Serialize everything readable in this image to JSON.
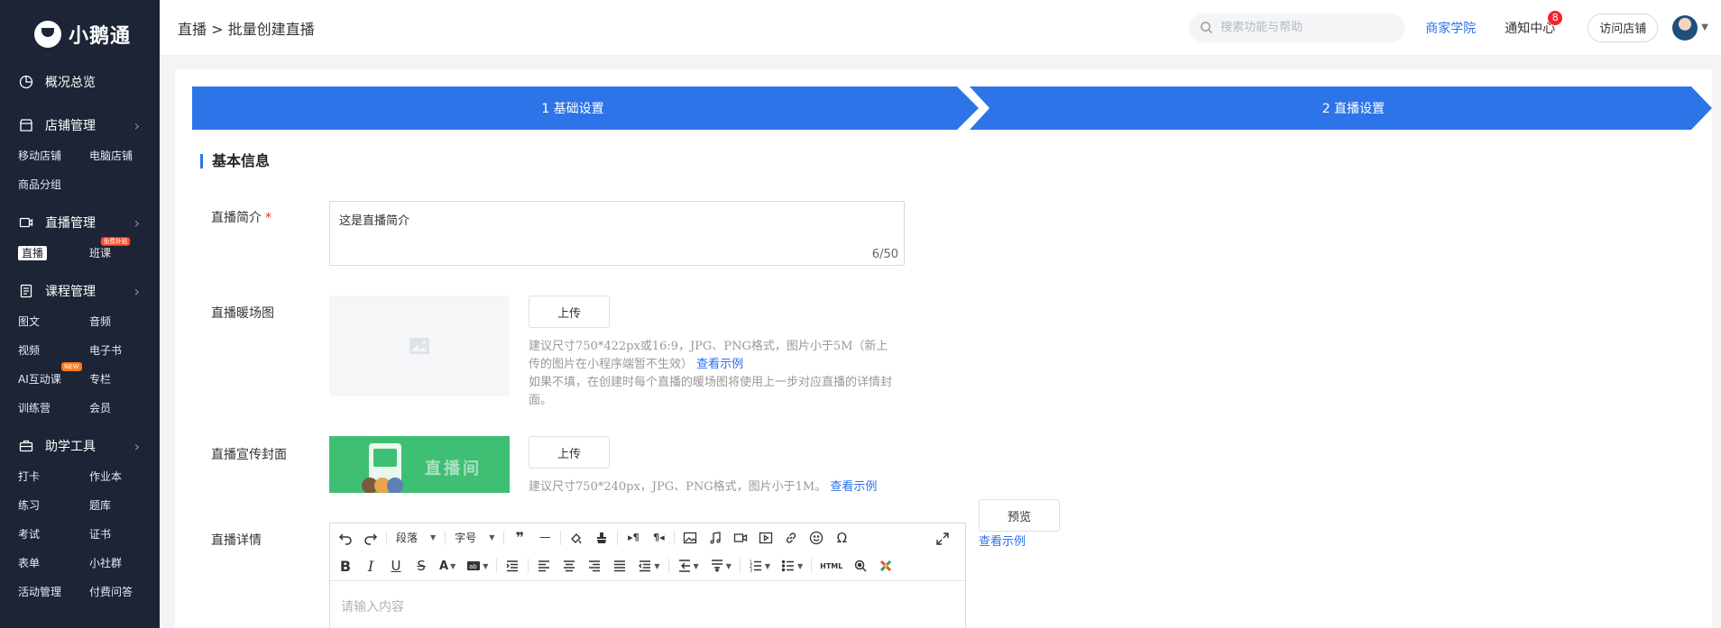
{
  "sidebar": {
    "logo_text": "小鹅通",
    "overview": "概况总览",
    "groups": [
      {
        "title": "店铺管理",
        "icon": "store-icon",
        "items": [
          "移动店铺",
          "电脑店铺",
          "商品分组"
        ]
      },
      {
        "title": "直播管理",
        "icon": "live-icon",
        "items": [
          "直播",
          "班课"
        ],
        "badge": "免费补贴"
      },
      {
        "title": "课程管理",
        "icon": "course-icon",
        "items": [
          "图文",
          "音频",
          "视频",
          "电子书",
          "AI互动课",
          "专栏",
          "训练营",
          "会员"
        ],
        "badge": "NEW"
      },
      {
        "title": "助学工具",
        "icon": "toolbox-icon",
        "items": [
          "打卡",
          "作业本",
          "练习",
          "题库",
          "考试",
          "证书",
          "表单",
          "小社群",
          "活动管理",
          "付费问答"
        ]
      }
    ]
  },
  "header": {
    "breadcrumb": "直播 > 批量创建直播",
    "search_placeholder": "搜索功能与帮助",
    "academy": "商家学院",
    "notice": "通知中心",
    "notice_count": "8",
    "visit_store": "访问店铺"
  },
  "steps": [
    "1 基础设置",
    "2 直播设置"
  ],
  "section_title": "基本信息",
  "form": {
    "intro_label": "直播简介",
    "required_mark": "*",
    "intro_value": "这是直播简介",
    "intro_count": "6/50",
    "warmup_label": "直播暖场图",
    "upload": "上传",
    "warmup_hint_1": "建议尺寸750*422px或16:9，JPG、PNG格式，图片小于5M（新上传的图片在小程序端暂不生效）",
    "example_link": "查看示例",
    "warmup_hint_2": "如果不填，在创建时每个直播的暖场图将使用上一步对应直播的详情封面。",
    "cover_label": "直播宣传封面",
    "cover_image_text": "直播间",
    "cover_hint": "建议尺寸750*240px，JPG、PNG格式，图片小于1M。",
    "detail_label": "直播详情",
    "preview": "预览",
    "editor": {
      "paragraph": "段落",
      "font_size": "字号",
      "html": "HTML",
      "placeholder": "请输入内容"
    }
  },
  "colors": {
    "primary": "#2d74e8",
    "sidebar_bg": "#1c2435",
    "link": "#2b6ff0",
    "danger": "#f5222d"
  }
}
